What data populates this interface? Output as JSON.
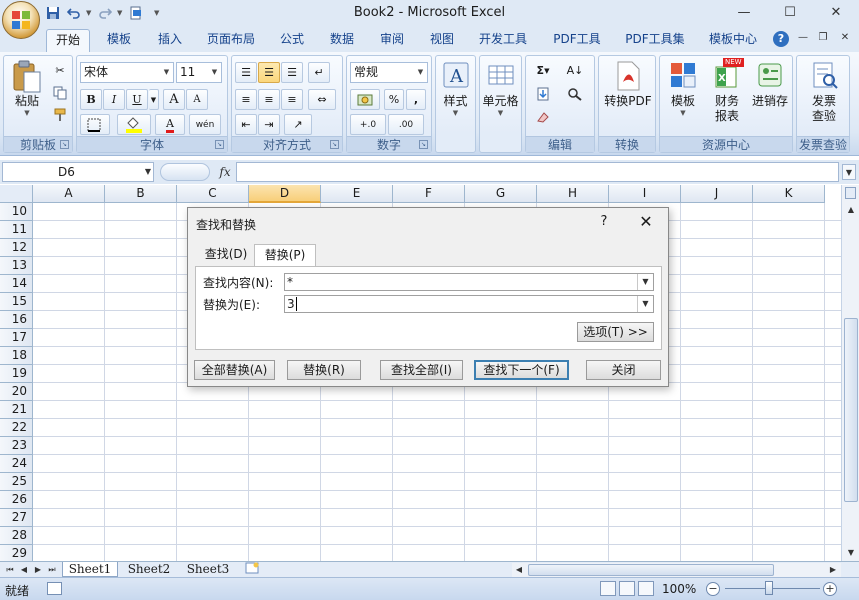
{
  "window": {
    "title": "Book2 - Microsoft Excel",
    "minimize_icon": "minimize-icon",
    "maximize_icon": "maximize-icon",
    "close_icon": "close-icon"
  },
  "qat": {
    "icons": [
      "save-icon",
      "undo-icon",
      "redo-icon",
      "print-preview-icon",
      "customize-icon"
    ]
  },
  "tabs": [
    "开始",
    "模板",
    "插入",
    "页面布局",
    "公式",
    "数据",
    "审阅",
    "视图",
    "开发工具",
    "PDF工具",
    "PDF工具集",
    "模板中心"
  ],
  "active_tab": "开始",
  "ribbon": {
    "clipboard": {
      "label": "剪贴板",
      "paste": "粘贴"
    },
    "font": {
      "label": "字体",
      "font_name": "宋体",
      "font_size": "11",
      "bold": "B",
      "italic": "I",
      "underline": "U",
      "grow": "A",
      "shrink": "A",
      "phonetic": "wén"
    },
    "alignment": {
      "label": "对齐方式"
    },
    "number": {
      "label": "数字",
      "format": "常规",
      "percent": "%",
      "comma": ",",
      "inc_decimal": "+.0",
      "dec_decimal": ".00"
    },
    "styles": {
      "label": "样式"
    },
    "cells": {
      "label": "单元格"
    },
    "editing": {
      "label": "编辑",
      "sum": "Σ"
    },
    "convert": {
      "label": "转换",
      "to_pdf": "转换PDF"
    },
    "resources": {
      "label": "资源中心",
      "template": "模板",
      "finance_1": "财务",
      "finance_2": "报表",
      "invoice": "进销存"
    },
    "invoice_check": {
      "label": "发票查验",
      "btn_1": "发票",
      "btn_2": "查验"
    },
    "new_badge": "NEW"
  },
  "formula_bar": {
    "name_box": "D6",
    "fx": "fx",
    "value": ""
  },
  "grid": {
    "columns": [
      "A",
      "B",
      "C",
      "D",
      "E",
      "F",
      "G",
      "H",
      "I",
      "J",
      "K"
    ],
    "active_column": "D",
    "rows": [
      "10",
      "11",
      "12",
      "13",
      "14",
      "15",
      "16",
      "17",
      "18",
      "19",
      "20",
      "21",
      "22",
      "23",
      "24",
      "25",
      "26",
      "27",
      "28",
      "29"
    ]
  },
  "sheets": [
    "Sheet1",
    "Sheet2",
    "Sheet3"
  ],
  "active_sheet": "Sheet1",
  "status": {
    "text": "就绪",
    "zoom": "100%"
  },
  "dialog": {
    "title": "查找和替换",
    "help": "?",
    "close": "✕",
    "tabs": [
      "查找(D)",
      "替换(P)"
    ],
    "active_tab": "替换(P)",
    "find_label": "查找内容(N):",
    "find_value": "*",
    "replace_label": "替换为(E):",
    "replace_value": "3",
    "options_button": "选项(T) >>",
    "buttons": {
      "replace_all": "全部替换(A)",
      "replace": "替换(R)",
      "find_all": "查找全部(I)",
      "find_next": "查找下一个(F)",
      "close": "关闭"
    }
  }
}
